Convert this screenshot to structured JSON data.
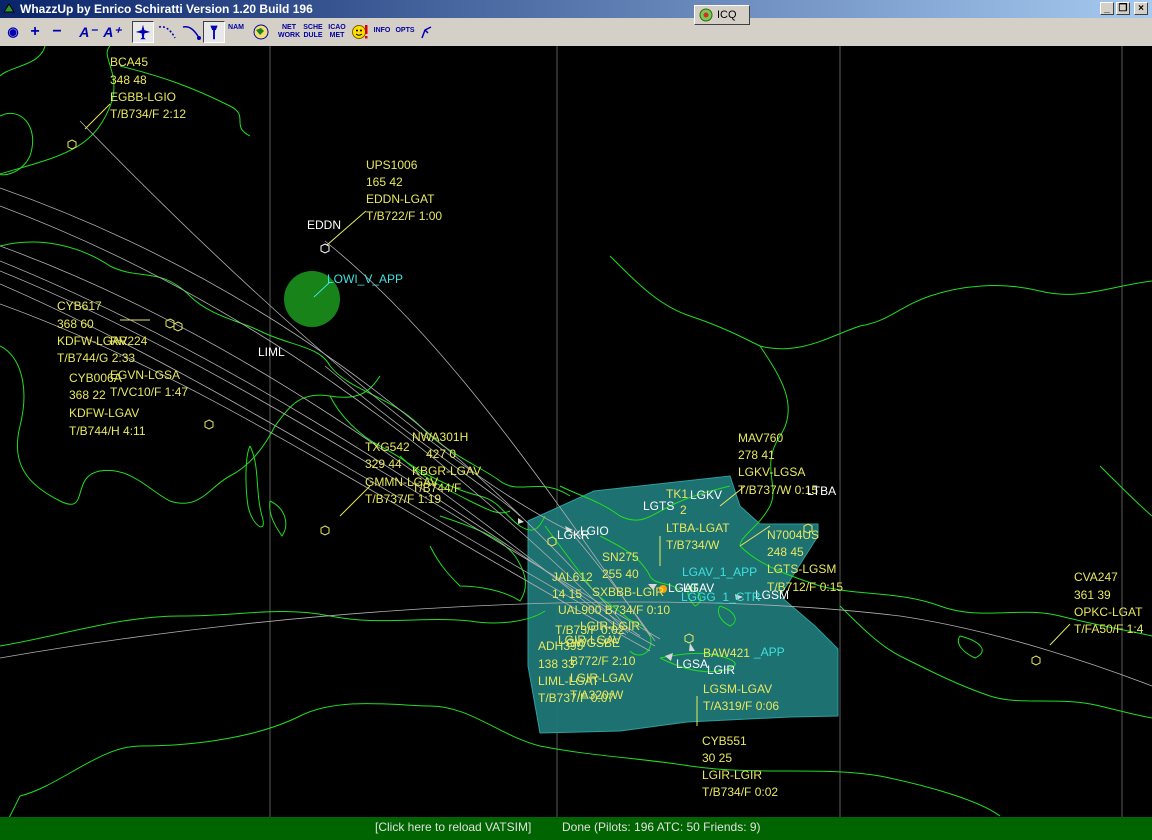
{
  "window": {
    "title": "WhazzUp by Enrico Schiratti Version 1.20 Build 196",
    "minimize_glyph": "_",
    "restore_glyph": "❐",
    "close_glyph": "×"
  },
  "icq": {
    "label": "ICQ"
  },
  "toolbar": {
    "globe": "◉",
    "zoom_in": "+",
    "zoom_out": "−",
    "font_smaller": "A⁻",
    "font_bigger": "A⁺",
    "nam": "NAM",
    "network": [
      "NET",
      "WORK"
    ],
    "schedule": [
      "SCHE",
      "DULE"
    ],
    "icao_met": [
      "ICAO",
      "MET"
    ],
    "info": "INFO",
    "opts": "OPTS"
  },
  "map": {
    "flights": [
      {
        "callsign": "BCA45",
        "alt_spd": "348 48",
        "route": "EGBB-LGIO",
        "info": "T/B734/F 2:12"
      },
      {
        "callsign": "UPS1006",
        "alt_spd": "165 42",
        "route": "EDDN-LGAT",
        "info": "T/B722/F 1:00"
      },
      {
        "callsign": "CYB617",
        "alt_spd": "368 60",
        "route": "KDFW-LGAV",
        "info": "T/B744/G 2:33"
      },
      {
        "callsign": "CYB006A",
        "alt_spd": "368 22",
        "route": "KDFW-LGAV",
        "info": "T/B744/H 4:11"
      },
      {
        "callsign": "TXG542",
        "alt_spd": "329 44",
        "route": "GMMN-LGAV",
        "info": "T/B737/F 1:19"
      },
      {
        "callsign": "NWA301H",
        "alt_spd": "427 0",
        "route": "KBGR-LGAV",
        "info": "T/B744/F"
      },
      {
        "callsign": "MAV760",
        "alt_spd": "278 41",
        "route": "LGKV-LGSA",
        "info": "T/B737/W 0:15"
      },
      {
        "callsign": "N7004US",
        "alt_spd": "248 45",
        "route": "LGTS-LGSM",
        "info": "T/B712/F 0:15"
      },
      {
        "callsign": "CVA247",
        "alt_spd": "361 39",
        "route": "OPKC-LGAT",
        "info": "T/FA50/F 1:4"
      },
      {
        "callsign": "CYB551",
        "alt_spd": "30 25",
        "route": "LGIR-LGIR",
        "info": "T/B734/F 0:02"
      },
      {
        "callsign": "JAL612",
        "alt_spd": "14 15",
        "route": "LGIR-LGAV",
        "info": "T/B73/F 0:02"
      },
      {
        "callsign": "SN275",
        "alt_spd": "255 40",
        "route": "LTBA-LGAT",
        "info": "T/B734/W"
      },
      {
        "callsign": "ADH395",
        "alt_spd": "138 33",
        "route": "LIML-LGAT",
        "info": "T/B737/F 0:07"
      },
      {
        "callsign": "BAW421",
        "alt_spd": "",
        "route": "LGSM-LGAV",
        "info": "T/A319/F 0:06"
      }
    ],
    "overlap": {
      "rr224": "RR224",
      "egvn": "EGVN-LGSA",
      "tvc10": "T/VC10/F 1:47",
      "tk1": "TK1",
      "lgkv_dup": "LGKV",
      "n2": "2",
      "sxbbb": "SXBBB-LGIR",
      "ual900": "UAL900 B734/F 0:10",
      "lgir_lgir": "LGIR-LGIR",
      "b772": "B772/F 2:10",
      "lgir_lgav": "LGIR-LGAV",
      "a320": "T/A320/W",
      "gwgsbe": "GWGSBE"
    },
    "airports": {
      "eddn": "EDDN",
      "liml": "LIML",
      "lgkr": "LGKR",
      "lgio": "LGIO",
      "lgts": "LGTS",
      "ltba": "LTBA",
      "lgkv": "LGKV",
      "lgat": "LGAT",
      "lgav": "LGAV",
      "lgsm": "LGSM",
      "lgsa": "LGSA",
      "lgir": "LGIR"
    },
    "atc": {
      "lowi": "LOWI_V_APP",
      "lgav_app": "LGAV_1_APP",
      "lggg": "LGGG_1_CTR",
      "app_suffix": "_APP"
    }
  },
  "status": {
    "reload": "[Click here to reload VATSIM]",
    "done": "Done (Pilots: 196  ATC: 50  Friends: 9)"
  },
  "colors": {
    "coastline": "#22dd22",
    "label": "#e8e860",
    "atc": "#40e0e0",
    "fir": "#1f7777",
    "status_bg": "#006400"
  }
}
